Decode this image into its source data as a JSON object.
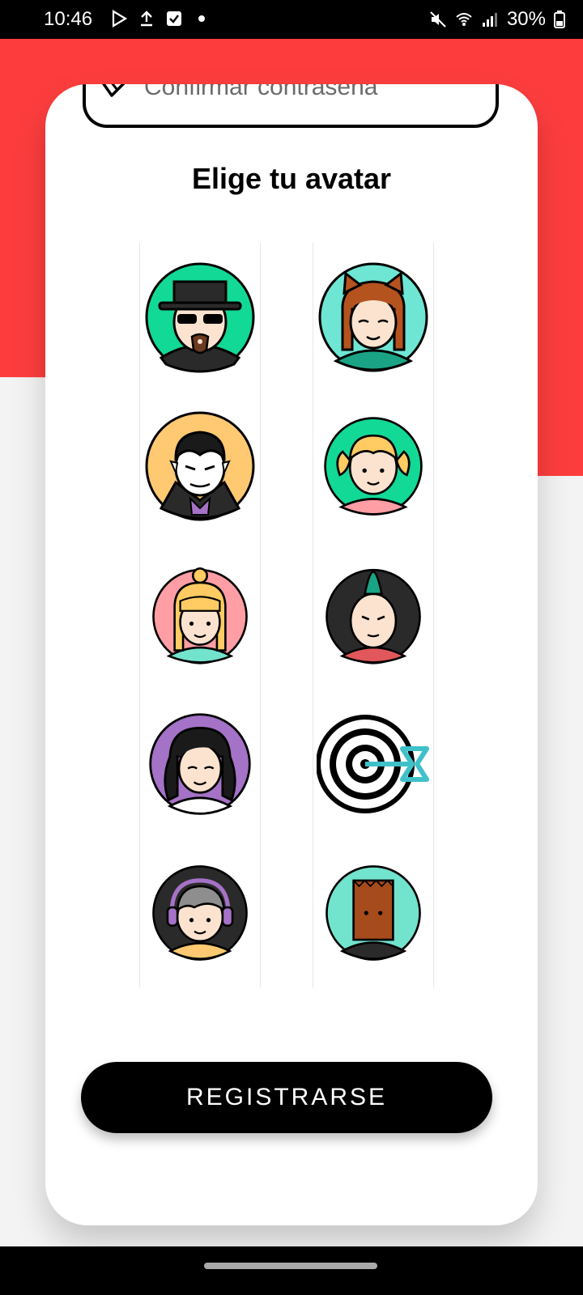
{
  "status_bar": {
    "time": "10:46",
    "battery": "30%",
    "left_icons": [
      "play-store-icon",
      "upload-icon",
      "checkbox-icon",
      "dot-icon"
    ],
    "right_icons": [
      "mute-icon",
      "wifi-icon",
      "signal-icon",
      "battery-icon"
    ]
  },
  "colors": {
    "accent_red": "#fd3d3d",
    "button": "#000000"
  },
  "form": {
    "confirm_password_placeholder": "Confirmar contrasena",
    "avatar_title": "Elige tu avatar",
    "register_label": "REGISTRARSE"
  },
  "avatars": [
    "heisenberg-avatar",
    "cat-ears-girl-avatar",
    "vampire-avatar",
    "pigtails-girl-avatar",
    "blonde-bun-girl-avatar",
    "mohawk-boy-avatar",
    "curly-hair-woman-avatar",
    "target-dart-icon",
    "headphones-boy-avatar",
    "paper-bag-head-avatar"
  ]
}
